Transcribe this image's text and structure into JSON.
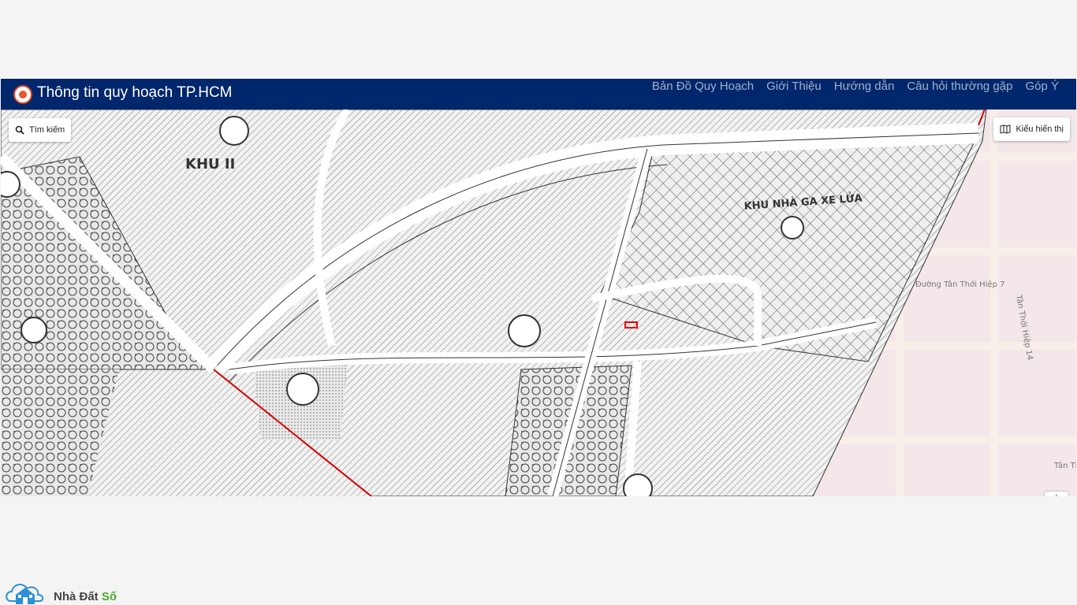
{
  "header": {
    "title": "Thông tin quy hoạch TP.HCM",
    "nav": [
      {
        "label": "Bản Đồ Quy Hoạch"
      },
      {
        "label": "Giới Thiệu"
      },
      {
        "label": "Hướng dẫn"
      },
      {
        "label": "Câu hỏi thường gặp"
      },
      {
        "label": "Góp Ý"
      }
    ]
  },
  "map": {
    "search_label": "Tìm kiếm",
    "style_label": "Kiểu hiển thị",
    "zoom_in_label": "+",
    "labels": {
      "khu2": "KHU II",
      "khu_nha_ga": "KHU NHÀ GA XE LỬA",
      "street1": "Đường Tân Thới Hiệp 7",
      "street2": "Tân Thới Hiệp 14",
      "street3": "Tân Th"
    }
  },
  "footer": {
    "brand_part1": "Nhà Đất ",
    "brand_part2": "Số"
  },
  "colors": {
    "navbar": "#00266b",
    "boundary": "#d40000",
    "map_outside": "#f3e7ea"
  }
}
